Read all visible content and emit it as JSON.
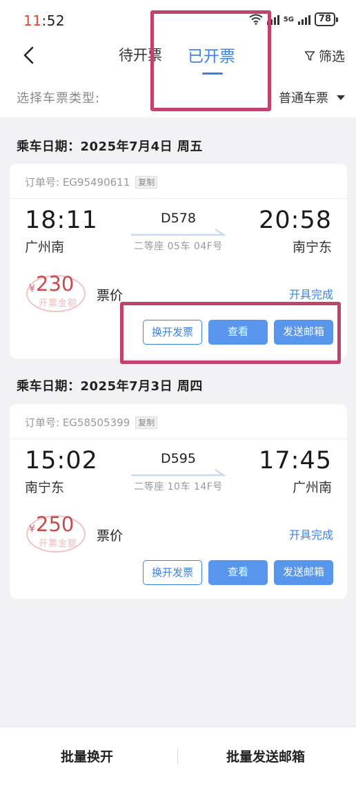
{
  "status_bar": {
    "time_red": "11",
    "time_rest": ":52",
    "network_label": "5G",
    "battery": "78"
  },
  "header": {
    "tabs": [
      {
        "label": "待开票",
        "active": false
      },
      {
        "label": "已开票",
        "active": true
      }
    ],
    "filter_label": "筛选"
  },
  "ticket_type": {
    "label": "选择车票类型:",
    "selected": "普通车票"
  },
  "groups": [
    {
      "date_label": "乘车日期：2025年7月4日 周五",
      "order_label": "订单号: EG95490611",
      "copy_label": "复制",
      "departure_time": "18:11",
      "departure_station": "广州南",
      "train_no": "D578",
      "seat": "二等座 05车 04F号",
      "arrival_time": "20:58",
      "arrival_station": "南宁东",
      "amount": "230",
      "currency": "¥",
      "stamp_text": "开票金额",
      "price_label": "票价",
      "status": "开具完成",
      "buttons": {
        "reissue": "换开发票",
        "view": "查看",
        "email": "发送邮箱"
      }
    },
    {
      "date_label": "乘车日期：2025年7月3日 周四",
      "order_label": "订单号: EG58505399",
      "copy_label": "复制",
      "departure_time": "15:02",
      "departure_station": "南宁东",
      "train_no": "D595",
      "seat": "二等座 10车 14F号",
      "arrival_time": "17:45",
      "arrival_station": "广州南",
      "amount": "250",
      "currency": "¥",
      "stamp_text": "开票金额",
      "price_label": "票价",
      "status": "开具完成",
      "buttons": {
        "reissue": "换开发票",
        "view": "查看",
        "email": "发送邮箱"
      }
    }
  ],
  "bottom_bar": {
    "batch_reissue": "批量换开",
    "batch_email": "批量发送邮箱"
  },
  "colors": {
    "accent": "#3b82e6",
    "button_fill": "#5895ec",
    "amount_red": "#cc4a4a",
    "highlight_box": "#c0436c"
  }
}
